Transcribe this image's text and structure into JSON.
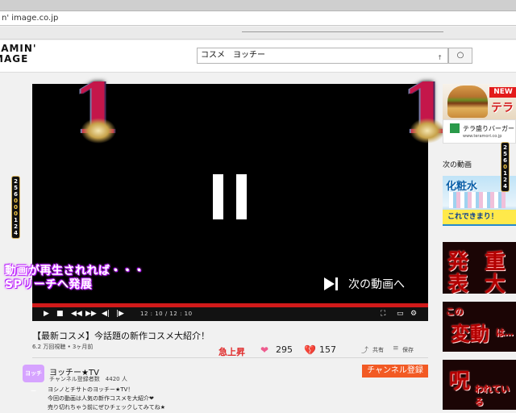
{
  "browser": {
    "url": "n' image.co.jp"
  },
  "header": {
    "logo_line1": "EAMIN'",
    "logo_line2": "MAGE",
    "search_value": "コスメ　ヨッチー",
    "search_button": "○"
  },
  "player": {
    "overlay_line1": "動画が再生されれば・・・",
    "overlay_line2": "SPリーチへ発展",
    "next_label": "次の動画へ",
    "time": "12 : 10 / 12 : 10",
    "progress": 1.0,
    "big_digit": "1"
  },
  "reel_left": [
    "2",
    "5",
    "6",
    "0",
    "0",
    "0",
    "1",
    "2",
    "4"
  ],
  "reel_right": [
    "2",
    "5",
    "6",
    "0",
    "1",
    "2",
    "4"
  ],
  "video": {
    "title": "【最新コスメ】今話題の新作コスメ大紹介！",
    "views": "6.2 万回視聴 • 3ヶ月前",
    "surge": "急上昇",
    "likes": "295",
    "dislikes": "157",
    "share": "共有",
    "save": "保存"
  },
  "channel": {
    "avatar_text": "ヨッチー",
    "name": "ヨッチー★TV",
    "subs": "チャンネル登録者数　4420 人",
    "subscribe": "チャンネル登録",
    "desc_line1": "ヨシノとチサトのヨッチー★TV！",
    "desc_line2": "今回の動画は人気の新作コスメを大紹介❤",
    "desc_line3": "売り切れちゃう前にぜひチェックしてみてね★"
  },
  "sidebar": {
    "ad_new": "NEW",
    "ad_tera": "テラ",
    "ad_name": "テラ盛りバーガー",
    "ad_url": "www.teramori.co.jp",
    "next_label": "次の動画",
    "thumb1_head": "化粧水",
    "thumb1_tag": "これできまり！",
    "thumb2_a": "発",
    "thumb2_b": "表",
    "thumb2_c": "重",
    "thumb2_d": "大",
    "thumb3_a": "この",
    "thumb3_b": "変動",
    "thumb3_c": "は…",
    "thumb4_a": "呪",
    "thumb4_b": "われている"
  }
}
